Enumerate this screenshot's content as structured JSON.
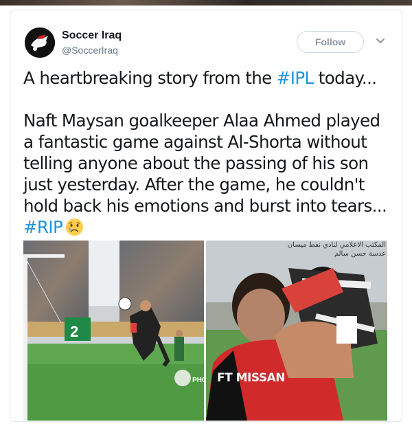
{
  "account": {
    "display_name": "Soccer Iraq",
    "handle": "@SoccerIraq",
    "avatar_icon": "soccer-iraq-logo-icon"
  },
  "follow_button": {
    "label": "Follow"
  },
  "menu_icon": "chevron-down-icon",
  "tweet": {
    "line1_text": "A heartbreaking story from the ",
    "line1_hashtag": "#IPL",
    "line1_tail": " today...",
    "body_lines": [
      "Naft Maysan goalkeeper Alaa Ahmed played",
      "a fantastic game against Al-Shorta without",
      "telling anyone about the passing of his son",
      "just yesterday. After the game, he couldn't",
      "hold back his emotions and burst into tears..."
    ],
    "closing_hashtag": "#RIP",
    "closing_emoji": "crying-face-icon"
  },
  "media": {
    "left_photo_credit": "PHOT",
    "right_photo_watermark_line1": "المكتب الاعلامي لنادي نفط ميسان",
    "right_photo_watermark_line2": "عدسة حسن سالم",
    "jersey_text": "FT MISSAN",
    "stadium_board_text": "2"
  },
  "colors": {
    "hashtag": "#1b95e0",
    "text": "#14171a",
    "secondary": "#657786",
    "border": "#e1e8ed"
  }
}
